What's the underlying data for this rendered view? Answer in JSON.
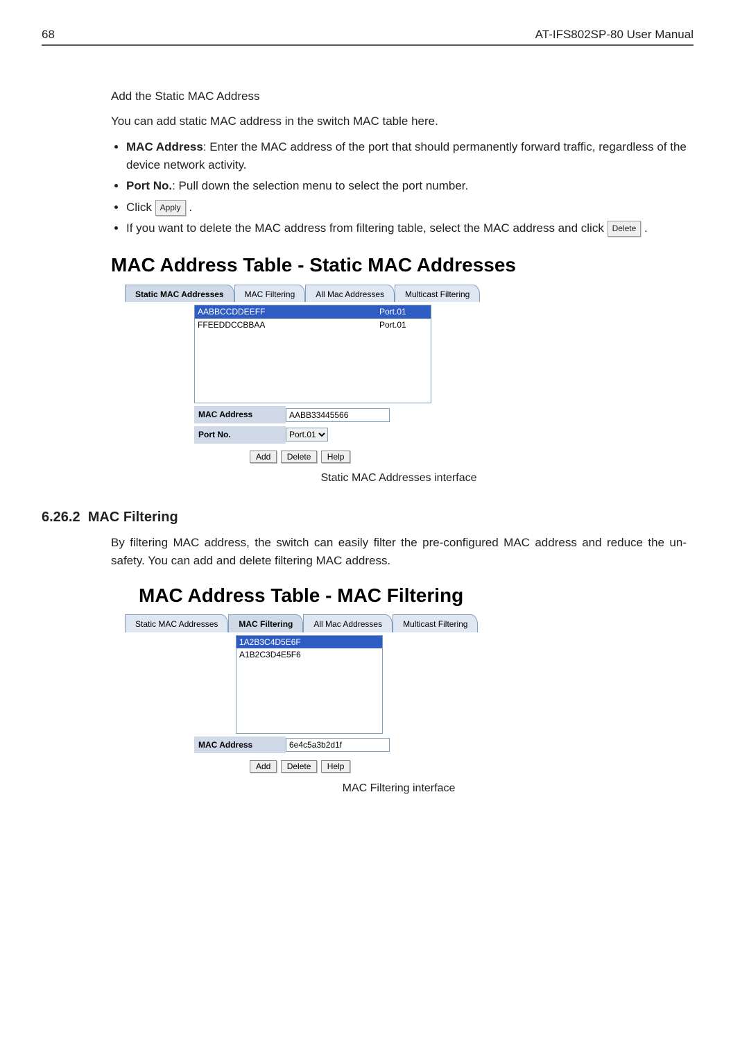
{
  "header": {
    "page_number": "68",
    "manual_title": "AT-IFS802SP-80 User Manual"
  },
  "intro": {
    "add_title": "Add the Static MAC Address",
    "add_desc": "You can add static MAC address in the switch MAC table here.",
    "bullets": {
      "mac_label": "MAC Address",
      "mac_rest": ": Enter the MAC address of the port that should permanently forward traffic, regardless of the device network activity.",
      "port_label": "Port No.",
      "port_rest": ": Pull down the selection menu to select the port number.",
      "click_word": "Click",
      "apply_btn": "Apply",
      "period": ".",
      "delete_line_a": "If you want to delete the MAC address from filtering table, select the MAC address and click",
      "delete_btn": "Delete",
      "delete_line_b": "."
    }
  },
  "fig1": {
    "title": "MAC Address Table - Static MAC Addresses",
    "tabs": {
      "t1": "Static MAC Addresses",
      "t2": "MAC Filtering",
      "t3": "All Mac Addresses",
      "t4": "Multicast Filtering"
    },
    "list": [
      {
        "mac": "AABBCCDDEEFF",
        "port": "Port.01",
        "selected": true
      },
      {
        "mac": "FFEEDDCCBBAA",
        "port": "Port.01",
        "selected": false
      }
    ],
    "form": {
      "mac_label": "MAC Address",
      "mac_value": "AABB33445566",
      "port_label": "Port No.",
      "port_value": "Port.01"
    },
    "buttons": {
      "add": "Add",
      "del": "Delete",
      "help": "Help"
    },
    "caption": "Static MAC Addresses interface"
  },
  "section": {
    "number": "6.26.2",
    "title": "MAC Filtering"
  },
  "filter_para": "By filtering MAC address, the switch can easily filter the pre-configured MAC address and reduce the un-safety. You can add and delete filtering MAC address.",
  "fig2": {
    "title": "MAC Address Table - MAC Filtering",
    "tabs": {
      "t1": "Static MAC Addresses",
      "t2": "MAC Filtering",
      "t3": "All Mac Addresses",
      "t4": "Multicast Filtering"
    },
    "list": [
      {
        "mac": "1A2B3C4D5E6F",
        "selected": true
      },
      {
        "mac": "A1B2C3D4E5F6",
        "selected": false
      }
    ],
    "form": {
      "mac_label": "MAC Address",
      "mac_value": "6e4c5a3b2d1f"
    },
    "buttons": {
      "add": "Add",
      "del": "Delete",
      "help": "Help"
    },
    "caption": "MAC Filtering interface"
  }
}
